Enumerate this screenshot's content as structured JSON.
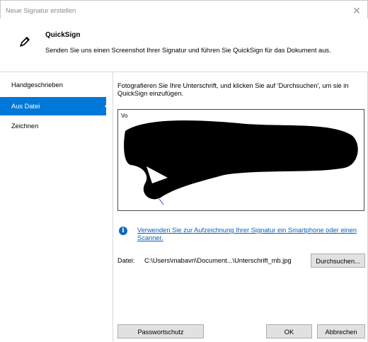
{
  "window": {
    "title": "Neue Signatur erstellen",
    "close_symbol": "✕"
  },
  "header": {
    "app_name": "QuickSign",
    "description": "Senden Sie uns einen Screenshot Ihrer Signatur und führen Sie QuickSign für das Dokument aus.",
    "icon": "pen-icon"
  },
  "sidebar": {
    "items": [
      {
        "label": "Handgeschrieben",
        "active": false
      },
      {
        "label": "Aus Datei",
        "active": true
      },
      {
        "label": "Zeichnen",
        "active": false
      }
    ]
  },
  "content": {
    "instruction": "Fotografieren Sie Ihre Unterschrift, und klicken Sie auf 'Durchsuchen', um sie in QuickSign einzufügen.",
    "preview_label": "Vo",
    "info_icon": "info-icon",
    "info_link": "Verwenden Sie zur Aufzeichnung Ihrer Signatur ein Smartphone oder einen Scanner.",
    "file_label": "Datei:",
    "file_path": "C:\\Users\\mabavri\\Document...\\Unterschrift_mb.jpg",
    "browse_button": "Durchsuchen..."
  },
  "footer": {
    "password_button": "Passwortschutz",
    "ok_button": "OK",
    "cancel_button": "Abbrechen"
  },
  "colors": {
    "accent": "#0078d7",
    "link": "#0b5fb8",
    "redaction": "#000000"
  }
}
